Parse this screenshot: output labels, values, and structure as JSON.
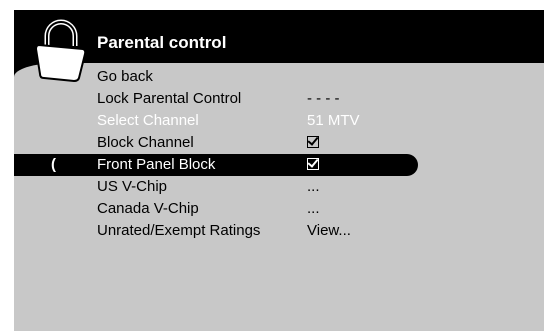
{
  "header": {
    "title": "Parental control",
    "icon": "padlock-icon"
  },
  "menu": {
    "items": [
      {
        "label": "Go back",
        "value": ""
      },
      {
        "label": "Lock Parental Control",
        "value": "- - - -"
      },
      {
        "label": "Select Channel",
        "value": "51 MTV",
        "state": "disabled"
      },
      {
        "label": "Block Channel",
        "value": "",
        "icon": "checkbox-checked-icon"
      },
      {
        "label": "Front Panel Block",
        "value": "",
        "icon": "checkbox-checked-icon",
        "state": "selected"
      },
      {
        "label": "US V-Chip",
        "value": "..."
      },
      {
        "label": "Canada V-Chip",
        "value": "..."
      },
      {
        "label": "Unrated/Exempt Ratings",
        "value": "View..."
      }
    ],
    "cursor_glyph": "("
  },
  "colors": {
    "background": "#000000",
    "panel": "#c8c8c8",
    "selection": "#000000",
    "text": "#000000",
    "disabled_text": "#ffffff"
  }
}
